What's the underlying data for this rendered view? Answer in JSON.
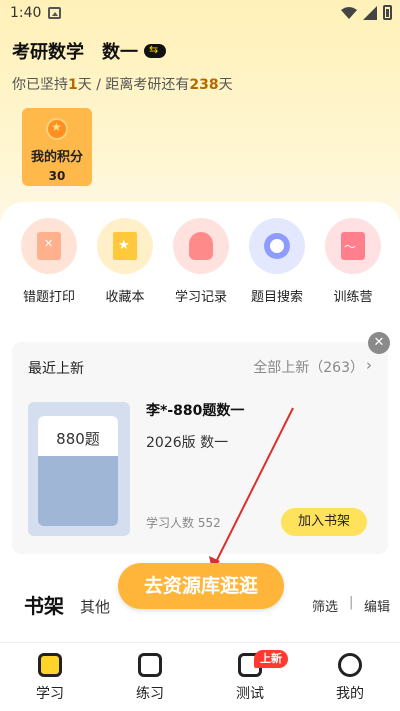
{
  "status_bar": {
    "time": "1:40"
  },
  "header": {
    "subject": "考研数学",
    "level": "数一"
  },
  "persist": {
    "prefix": "你已坚持",
    "days": "1",
    "mid": "天 / 距离考研还有",
    "remaining": "238",
    "suffix": "天"
  },
  "points_card": {
    "title": "我的积分",
    "value": "30"
  },
  "tools": [
    {
      "label": "错题打印",
      "icon": "print-icon"
    },
    {
      "label": "收藏本",
      "icon": "favorite-icon"
    },
    {
      "label": "学习记录",
      "icon": "footprint-icon"
    },
    {
      "label": "题目搜索",
      "icon": "search-icon"
    },
    {
      "label": "训练营",
      "icon": "training-icon"
    }
  ],
  "recent": {
    "title": "最近上新",
    "all_label": "全部上新（263）",
    "book": {
      "cover_text": "880题",
      "title": "李*-880题数一",
      "edition": "2026版 数一",
      "learners": "学习人数 552",
      "add_button": "加入书架"
    }
  },
  "bookshelf": {
    "title": "书架",
    "other": "其他",
    "filter": "筛选",
    "separator": "|",
    "edit": "编辑",
    "explore_button": "去资源库逛逛"
  },
  "bottom_nav": {
    "items": [
      {
        "label": "学习",
        "active": true
      },
      {
        "label": "练习",
        "active": false
      },
      {
        "label": "测试",
        "active": false
      },
      {
        "label": "我的",
        "active": false
      }
    ],
    "badge": "上新"
  },
  "colors": {
    "accent": "#ffd42a",
    "button_orange": "#ffb53a",
    "annotation_red": "#d9302a"
  }
}
